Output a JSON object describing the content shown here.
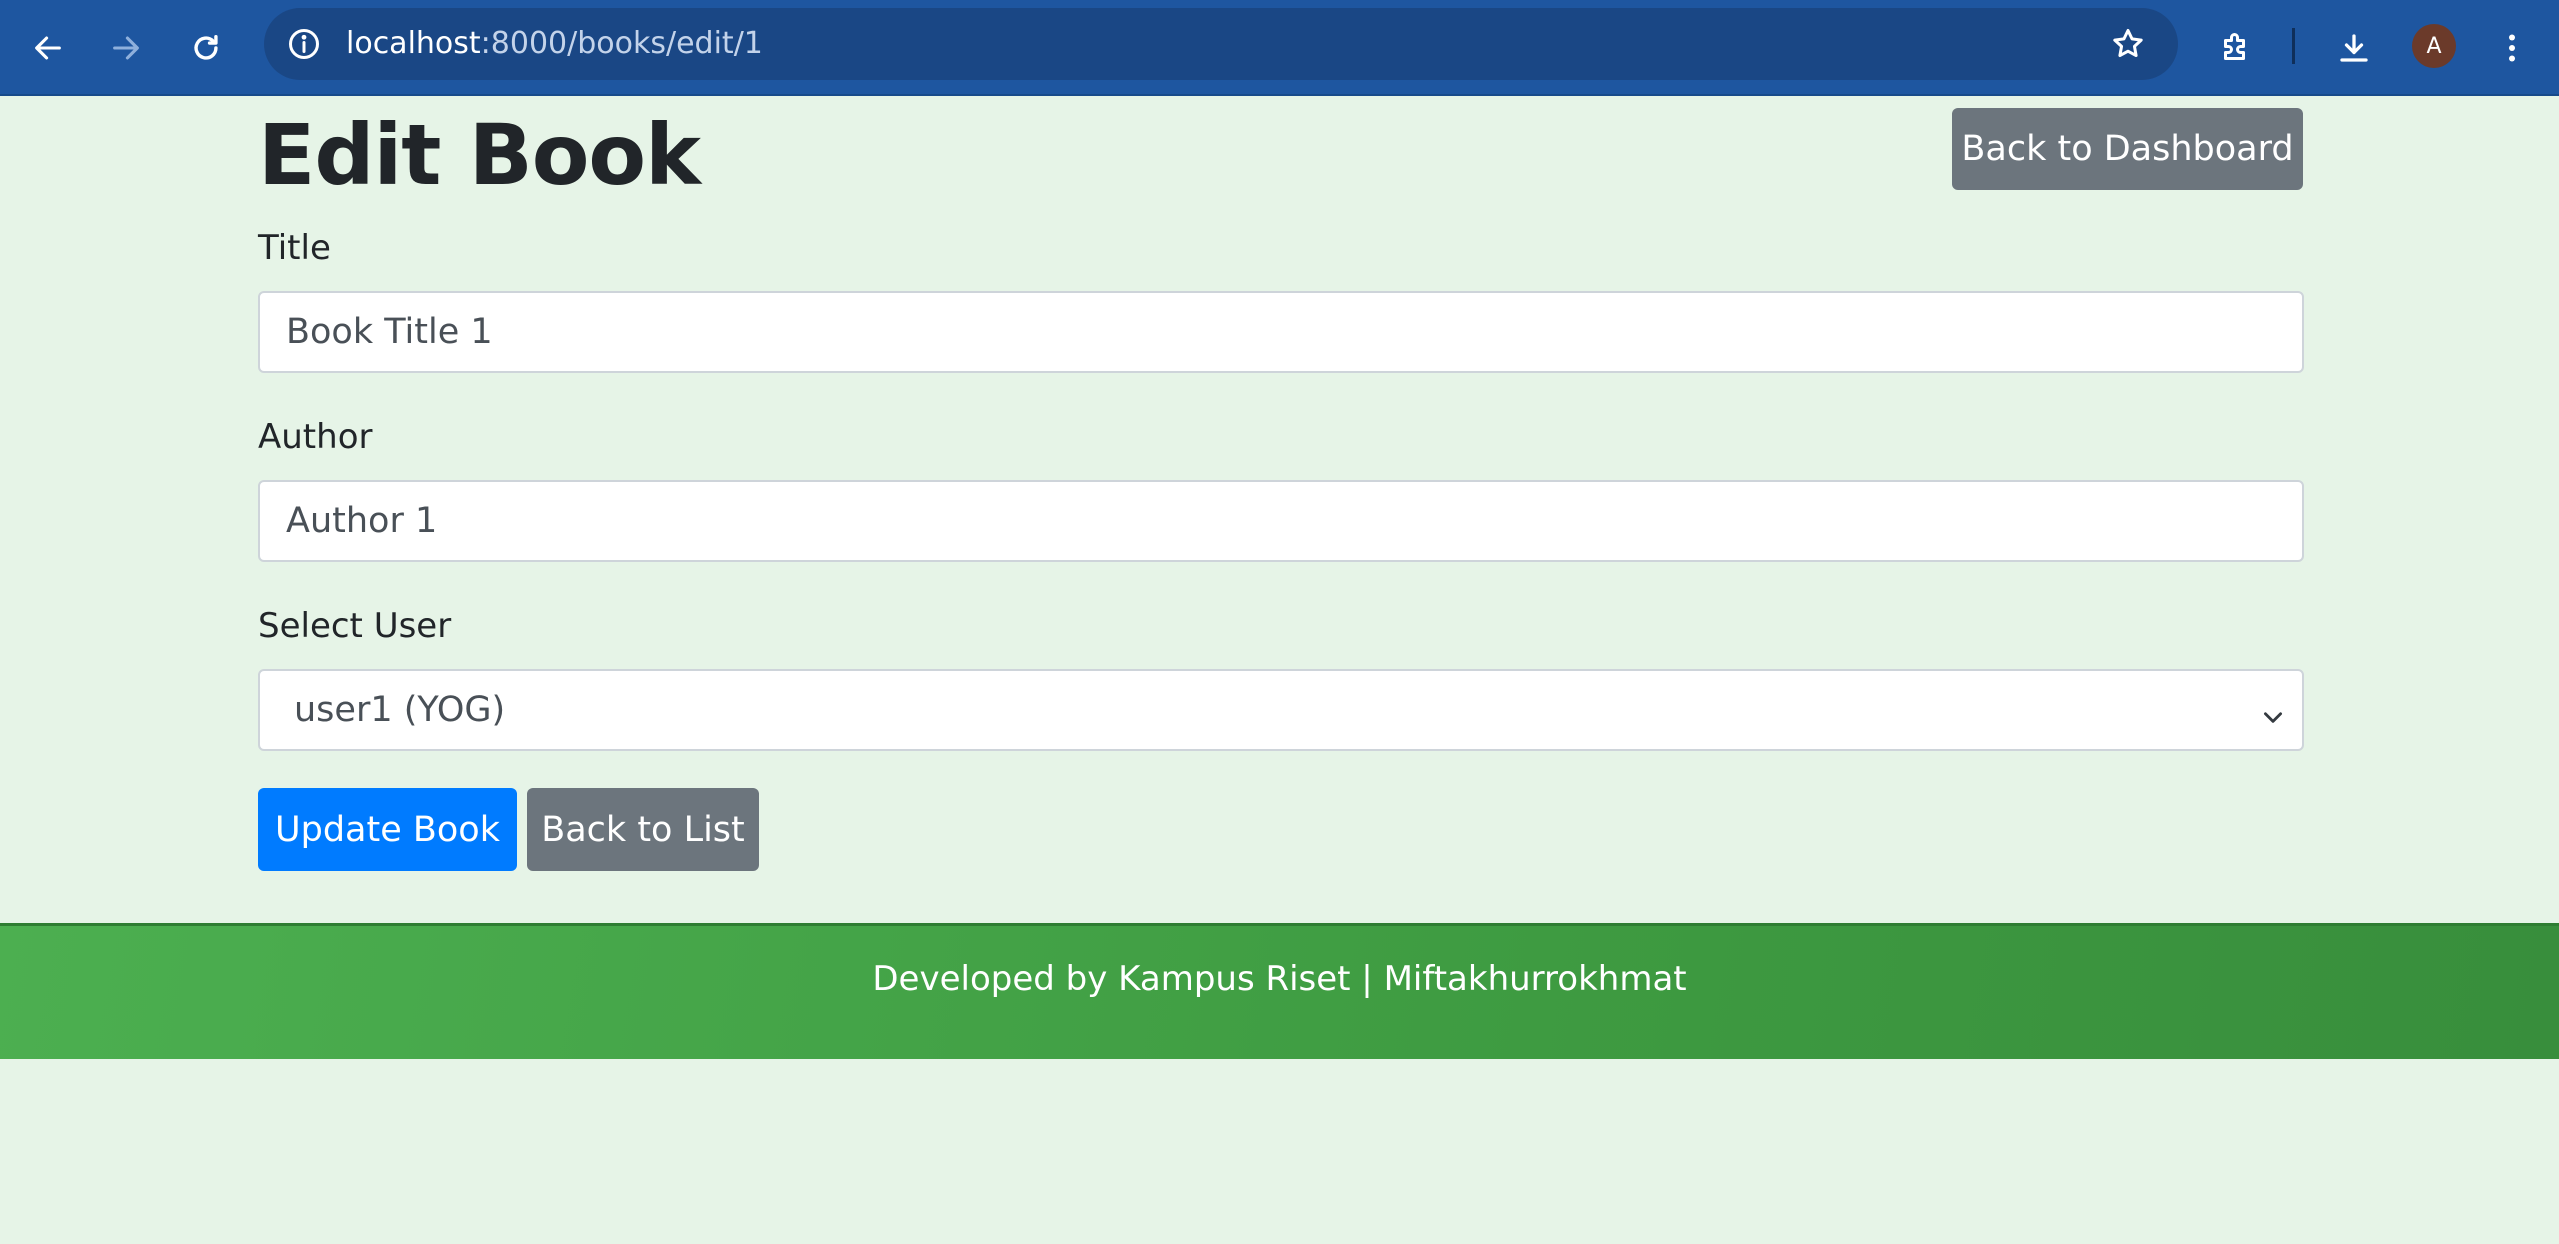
{
  "browser": {
    "url_host": "localhost",
    "url_path": ":8000/books/edit/1",
    "profile_initial": "A"
  },
  "page": {
    "title": "Edit Book",
    "back_to_dashboard": "Back to Dashboard"
  },
  "form": {
    "title_label": "Title",
    "title_value": "Book Title 1",
    "author_label": "Author",
    "author_value": "Author 1",
    "user_label": "Select User",
    "user_selected": "user1 (YOG)",
    "update_button": "Update Book",
    "back_to_list": "Back to List"
  },
  "footer": {
    "text": "Developed by Kampus Riset | Miftakhurrokhmat"
  },
  "colors": {
    "chrome": "#1e56a0",
    "page_bg": "#e6f4e7",
    "primary": "#007bff",
    "secondary": "#6c757d",
    "footer": "#4caf50"
  },
  "icons": [
    "back-arrow-icon",
    "forward-arrow-icon",
    "reload-icon",
    "site-info-icon",
    "bookmark-star-icon",
    "extensions-icon",
    "download-icon",
    "menu-dots-icon",
    "chevron-down-icon"
  ]
}
